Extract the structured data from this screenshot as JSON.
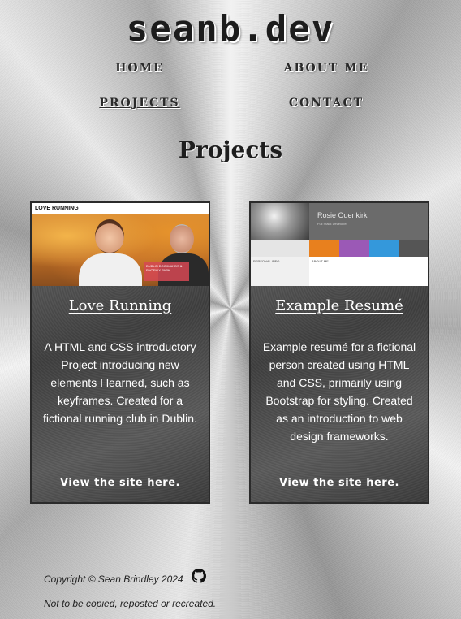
{
  "site": {
    "brand": "seanb.dev"
  },
  "nav": {
    "home": "HOME",
    "about": "ABOUT ME",
    "projects": "PROJECTS",
    "contact": "CONTACT"
  },
  "page": {
    "title": "Projects"
  },
  "projects": [
    {
      "title": "Love Running",
      "description": "A HTML and CSS introductory Project introducing new elements I learned, such as keyframes. Created for a fictional running club in Dublin.",
      "link": "View the site here.",
      "thumb": {
        "logo": "LOVE RUNNING",
        "overlay": "DUBLIN DOCKLANDS & PHOENIX PARK"
      }
    },
    {
      "title": "Example Resumé",
      "description": "Example resumé for a fictional person created using HTML and CSS, primarily using Bootstrap for styling. Created as an introduction to web design frameworks.",
      "link": "View the site here.",
      "thumb": {
        "name": "Rosie Odenkirk",
        "role": "Full Stack Developer",
        "left_heading": "PERSONAL INFO",
        "main_heading": "ABOUT ME"
      }
    }
  ],
  "footer": {
    "copyright": "Copyright © Sean Brindley 2024",
    "notice": "Not to be copied, reposted or recreated.",
    "github_icon": "github-icon"
  }
}
